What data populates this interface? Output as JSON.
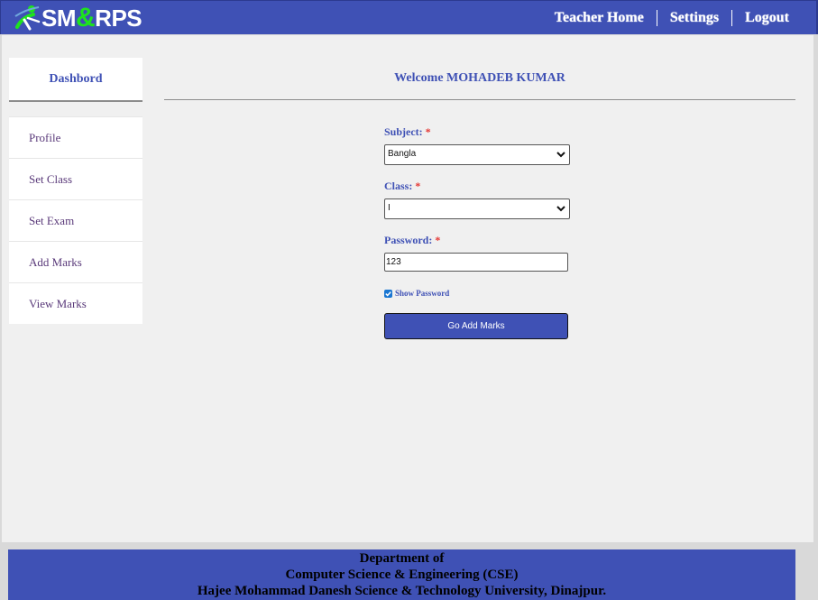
{
  "brand": {
    "logo_text_prefix": "SM",
    "logo_text_amp": "&",
    "logo_text_suffix": "RPS"
  },
  "nav": {
    "items": [
      {
        "label": "Teacher Home"
      },
      {
        "label": "Settings"
      },
      {
        "label": "Logout"
      }
    ]
  },
  "sidebar": {
    "title": "Dashbord",
    "items": [
      {
        "label": "Profile"
      },
      {
        "label": "Set Class"
      },
      {
        "label": "Set Exam"
      },
      {
        "label": "Add Marks"
      },
      {
        "label": "View Marks"
      }
    ]
  },
  "main": {
    "welcome": "Welcome MOHADEB KUMAR",
    "required_marker": "*",
    "subject": {
      "label": "Subject:",
      "value": "Bangla"
    },
    "class": {
      "label": "Class:",
      "value": "I"
    },
    "password": {
      "label": "Password:",
      "value": "123"
    },
    "show_password": {
      "label": "Show Password",
      "checked": true
    },
    "submit_label": "Go Add Marks"
  },
  "footer": {
    "line1": "Department of",
    "line2": "Computer Science & Engineering (CSE)",
    "line3": "Hajee Mohammad Danesh Science & Technology University, Dinajpur."
  },
  "colors": {
    "primary": "#3f51b5",
    "accent_green": "#1ee31e",
    "required": "#e53935",
    "background": "#f0f0f0"
  }
}
